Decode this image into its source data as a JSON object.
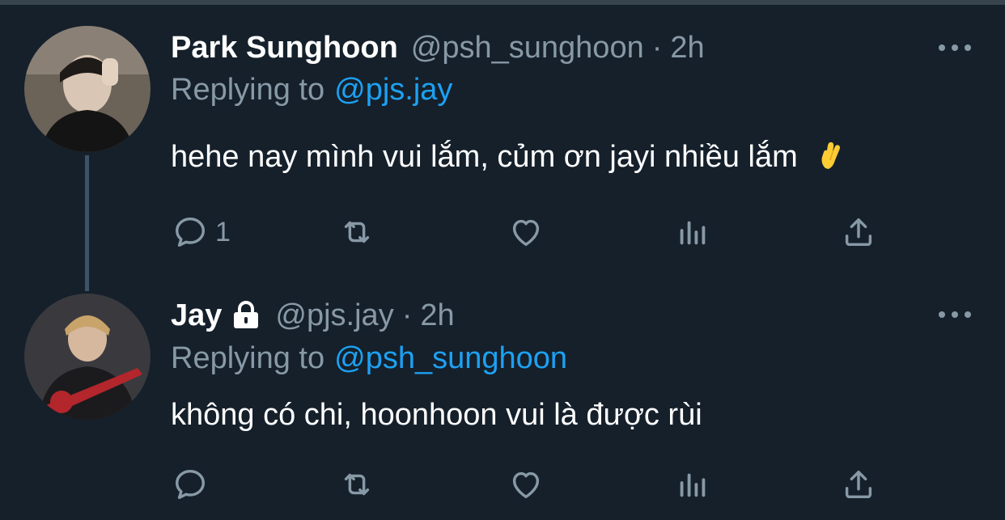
{
  "colors": {
    "background": "#15202b",
    "secondary_text": "#8899a6",
    "link": "#1da1f2",
    "thread_line": "#3d5466"
  },
  "tweets": [
    {
      "name": "Park Sunghoon",
      "handle": "@psh_sunghoon",
      "separator": "·",
      "time": "2h",
      "replying_label": "Replying to",
      "replying_to": "@pjs.jay",
      "text": "hehe nay mình vui lắm, củm ơn jayi nhiều lắm",
      "emoji": "hand-with-index-and-middle-fingers-crossed",
      "reply_count": "1",
      "icons": [
        "reply-icon",
        "retweet-icon",
        "like-icon",
        "stats-icon",
        "share-icon",
        "more-icon"
      ]
    },
    {
      "name": "Jay",
      "protected": true,
      "handle": "@pjs.jay",
      "separator": "·",
      "time": "2h",
      "replying_label": "Replying to",
      "replying_to": "@psh_sunghoon",
      "text": "không có chi, hoonhoon vui là được rùi",
      "reply_count": "",
      "icons": [
        "reply-icon",
        "retweet-icon",
        "like-icon",
        "stats-icon",
        "share-icon",
        "more-icon"
      ]
    }
  ]
}
